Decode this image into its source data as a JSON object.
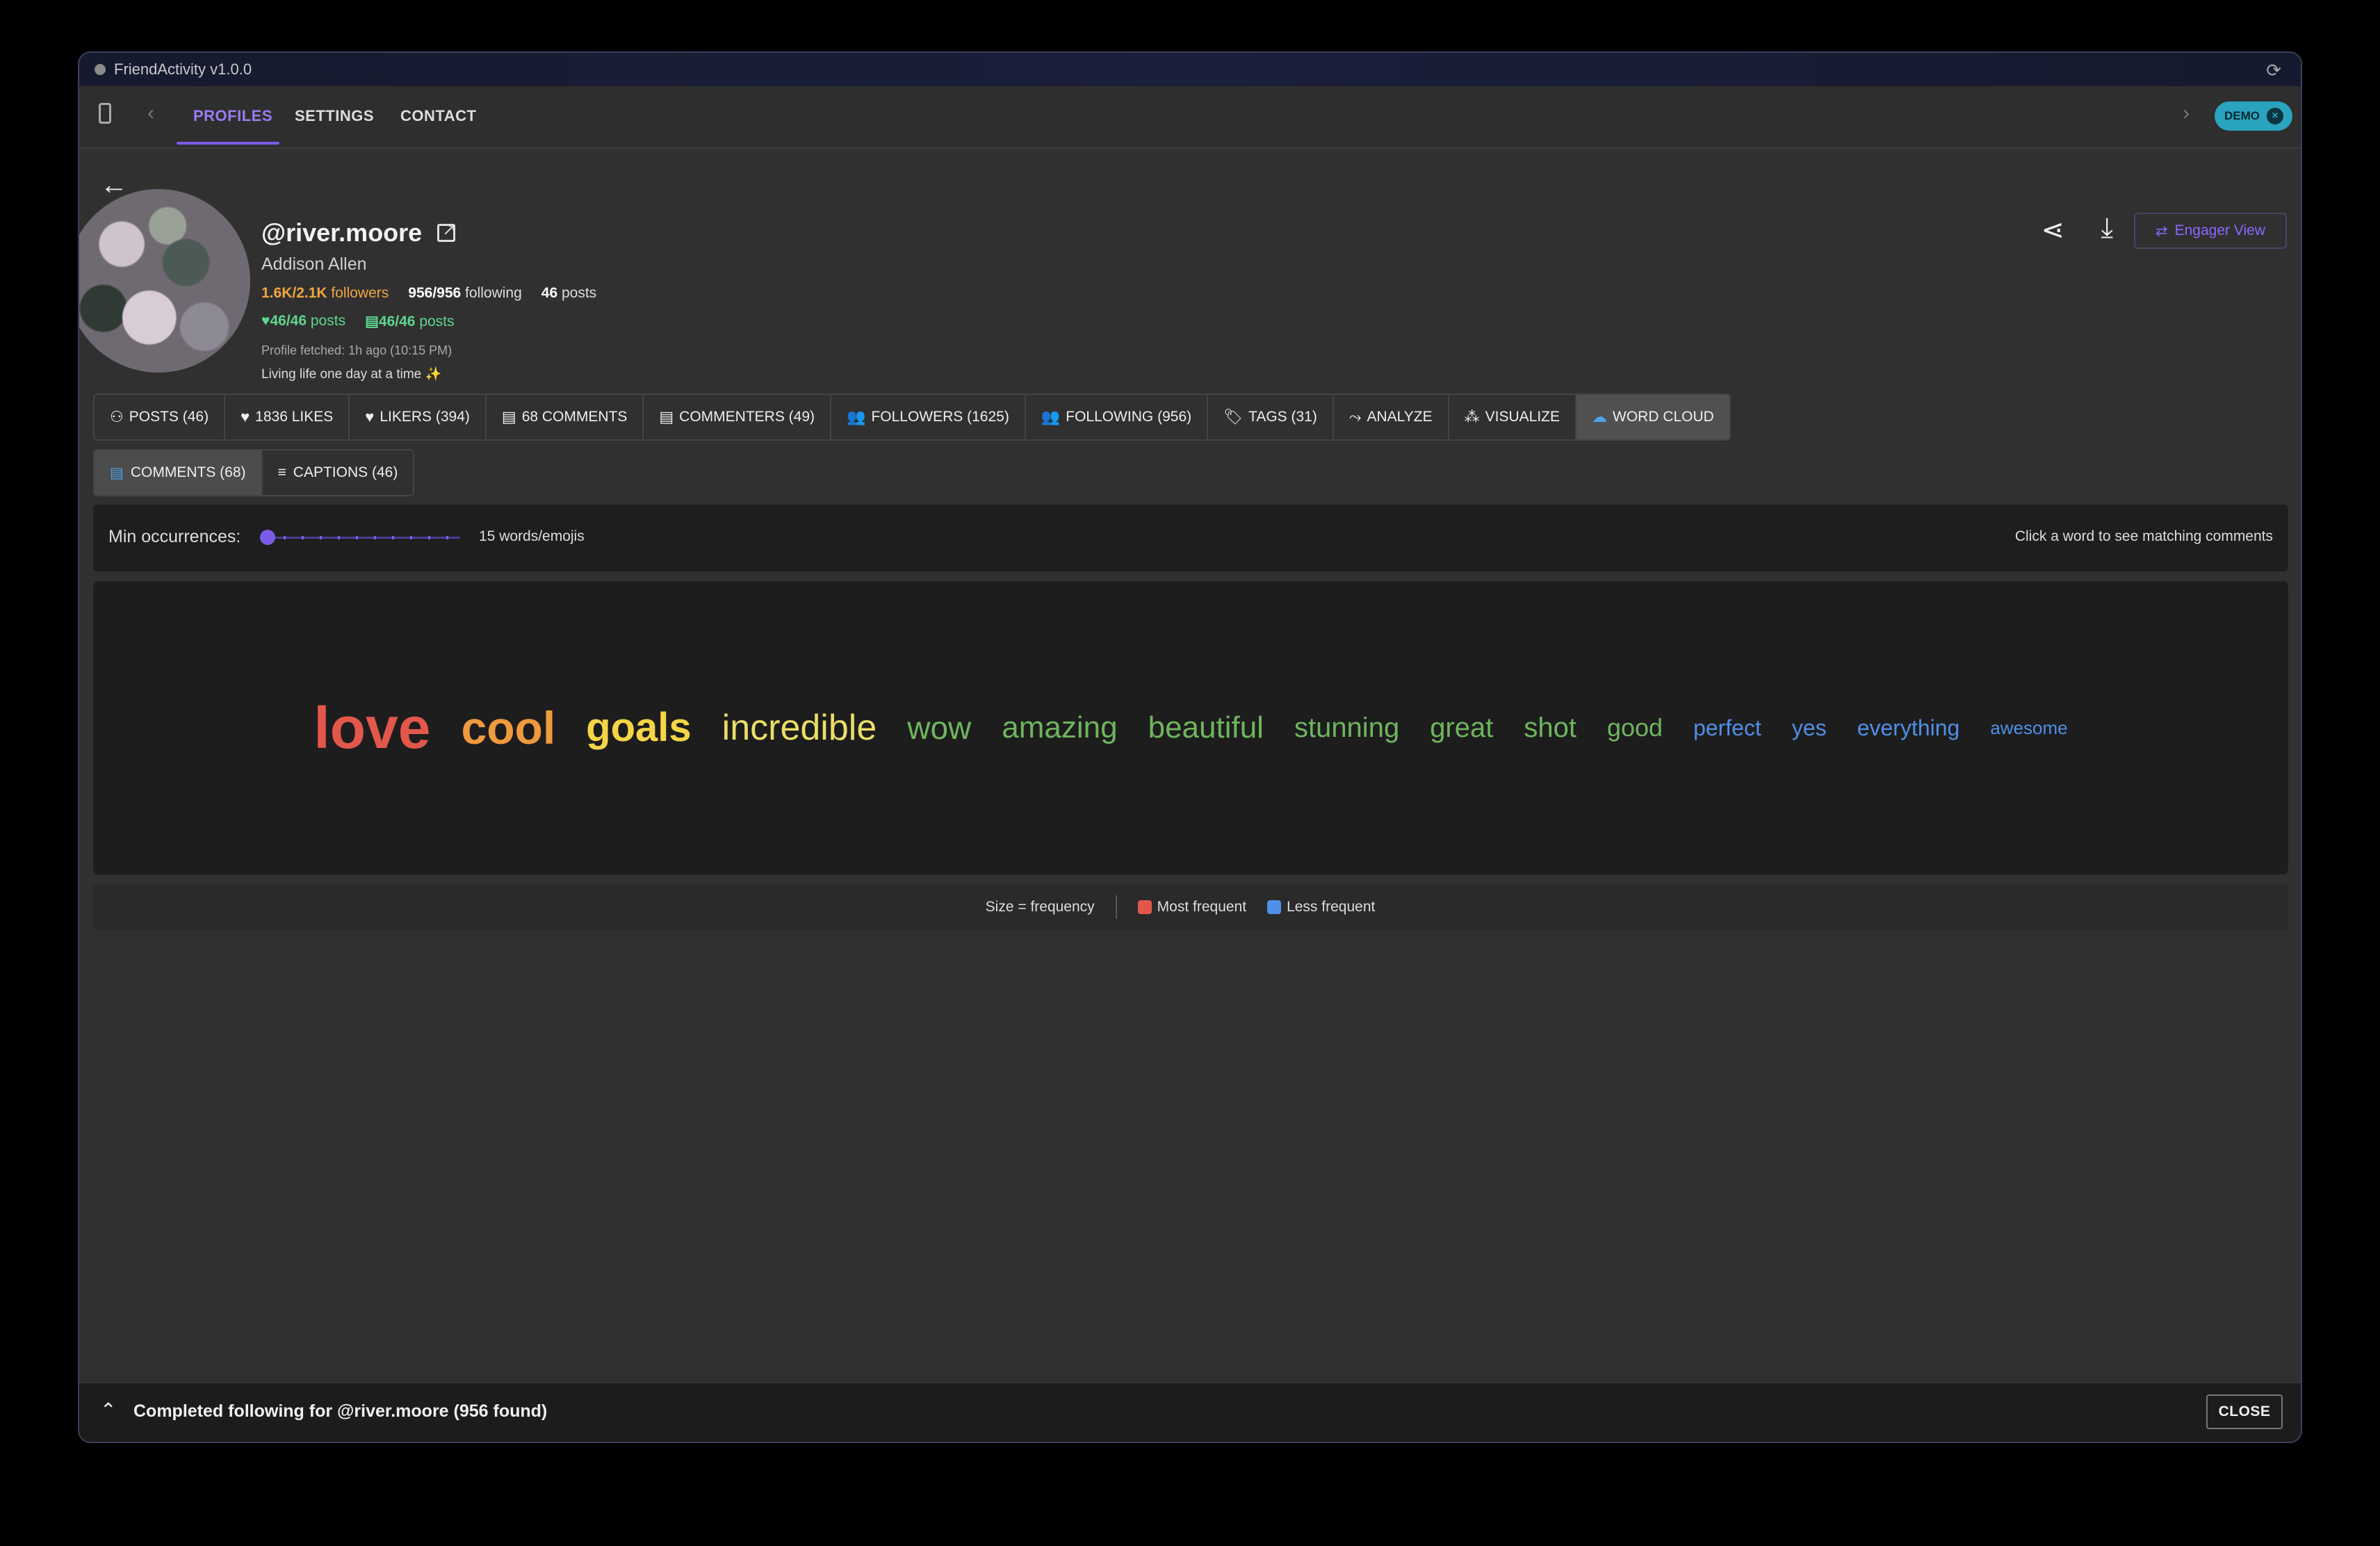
{
  "window": {
    "title": "FriendActivity v1.0.0"
  },
  "nav": {
    "tabs": [
      {
        "label": "PROFILES",
        "active": true
      },
      {
        "label": "SETTINGS",
        "active": false
      },
      {
        "label": "CONTACT",
        "active": false
      }
    ],
    "demo_badge": "DEMO"
  },
  "profile": {
    "username": "@river.moore",
    "full_name": "Addison Allen",
    "followers_value": "1.6K/2.1K",
    "followers_label": "followers",
    "following_value": "956/956",
    "following_label": "following",
    "posts_value": "46",
    "posts_label": "posts",
    "liked_posts_value": "46/46",
    "liked_posts_label": "posts",
    "commented_posts_value": "46/46",
    "commented_posts_label": "posts",
    "fetched": "Profile fetched: 1h ago (10:15 PM)",
    "bio": "Living life one day at a time ✨",
    "engager_view_label": "Engager View"
  },
  "main_tabs": [
    {
      "label": "POSTS (46)",
      "icon": "posts-icon",
      "glyph": "⚇"
    },
    {
      "label": "1836 LIKES",
      "icon": "heart-icon",
      "glyph": "♥"
    },
    {
      "label": "LIKERS (394)",
      "icon": "heart-icon",
      "glyph": "♥"
    },
    {
      "label": "68 COMMENTS",
      "icon": "comment-icon",
      "glyph": "▤"
    },
    {
      "label": "COMMENTERS (49)",
      "icon": "comment-icon",
      "glyph": "▤"
    },
    {
      "label": "FOLLOWERS (1625)",
      "icon": "people-icon",
      "glyph": "👥"
    },
    {
      "label": "FOLLOWING (956)",
      "icon": "people-icon",
      "glyph": "👥"
    },
    {
      "label": "TAGS (31)",
      "icon": "tag-icon",
      "glyph": "🏷"
    },
    {
      "label": "ANALYZE",
      "icon": "trend-icon",
      "glyph": "⤳"
    },
    {
      "label": "VISUALIZE",
      "icon": "bubbles-icon",
      "glyph": "⁂"
    },
    {
      "label": "WORD CLOUD",
      "icon": "cloud-icon",
      "glyph": "☁",
      "active": true
    }
  ],
  "sub_tabs": [
    {
      "label": "COMMENTS (68)",
      "icon": "comment-icon",
      "glyph": "▤",
      "active": true
    },
    {
      "label": "CAPTIONS (46)",
      "icon": "lines-icon",
      "glyph": "≡",
      "active": false
    }
  ],
  "filter": {
    "label": "Min occurrences:",
    "value_text": "15 words/emojis",
    "hint": "Click a word to see matching comments"
  },
  "word_cloud": {
    "words": [
      {
        "text": "love",
        "color": "#e2574c"
      },
      {
        "text": "cool",
        "color": "#ef9a3e"
      },
      {
        "text": "goals",
        "color": "#f5d547"
      },
      {
        "text": "incredible",
        "color": "#eade6a"
      },
      {
        "text": "wow",
        "color": "#6fb55d"
      },
      {
        "text": "amazing",
        "color": "#6fb55d"
      },
      {
        "text": "beautiful",
        "color": "#6fb55d"
      },
      {
        "text": "stunning",
        "color": "#6fb55d"
      },
      {
        "text": "great",
        "color": "#6fb55d"
      },
      {
        "text": "shot",
        "color": "#6fb55d"
      },
      {
        "text": "good",
        "color": "#6fb55d"
      },
      {
        "text": "perfect",
        "color": "#4f8fe8"
      },
      {
        "text": "yes",
        "color": "#4f8fe8"
      },
      {
        "text": "everything",
        "color": "#4f8fe8"
      },
      {
        "text": "awesome",
        "color": "#4f8fe8"
      }
    ]
  },
  "legend": {
    "size_text": "Size = frequency",
    "most_label": "Most frequent",
    "most_color": "#e2574c",
    "less_label": "Less frequent",
    "less_color": "#4f8fe8"
  },
  "status": {
    "message": "Completed following for @river.moore (956 found)",
    "close_label": "CLOSE"
  }
}
